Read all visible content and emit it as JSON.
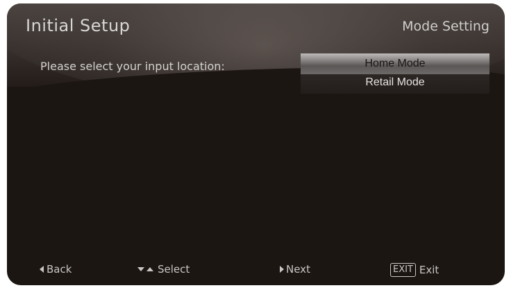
{
  "header": {
    "title": "Initial Setup",
    "section": "Mode Setting"
  },
  "prompt": "Please select your input location:",
  "options": [
    {
      "label": "Home Mode",
      "selected": true
    },
    {
      "label": "Retail Mode",
      "selected": false
    }
  ],
  "footer": {
    "back_label": "Back",
    "select_label": "Select",
    "next_label": "Next",
    "exit_key": "EXIT",
    "exit_label": "Exit"
  },
  "icons": {
    "back": "triangle-left-icon",
    "select": "triangle-down-up-icon",
    "next": "triangle-right-icon"
  },
  "colors": {
    "background": "#1c1613",
    "text": "#d4d2d1",
    "highlight": "#8d8a89"
  }
}
